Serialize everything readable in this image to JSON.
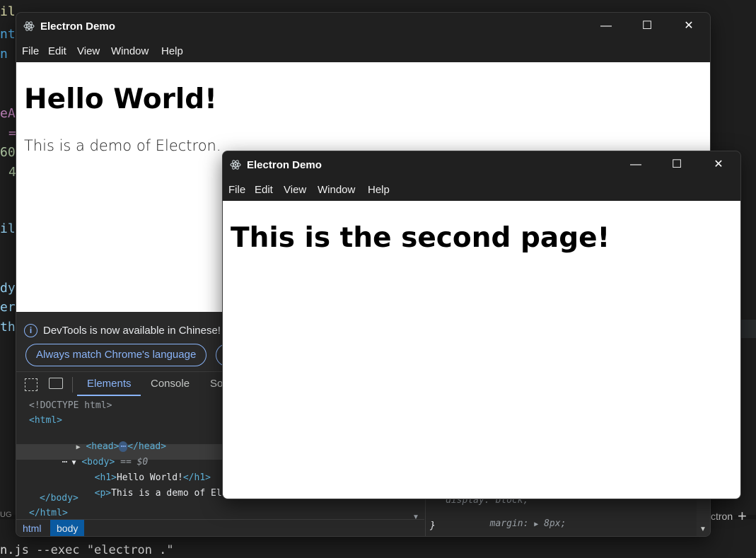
{
  "editor": {
    "code_fragments": [
      "il",
      "nt",
      "n",
      "eA",
      "=",
      "60",
      "4",
      "il",
      "dy",
      "er",
      "th"
    ],
    "terminal_command": "n.js --exec \"electron .\"",
    "status_left": "UG",
    "status_right": "ctron",
    "plus": "+"
  },
  "window_main": {
    "title": "Electron Demo",
    "menu": [
      "File",
      "Edit",
      "View",
      "Window",
      "Help"
    ],
    "controls": {
      "minimize": "—",
      "maximize": "☐",
      "close": "✕"
    },
    "heading": "Hello World!",
    "paragraph": "This is a demo of Electron."
  },
  "window_second": {
    "title": "Electron Demo",
    "menu": [
      "File",
      "Edit",
      "View",
      "Window",
      "Help"
    ],
    "controls": {
      "minimize": "—",
      "maximize": "☐",
      "close": "✕"
    },
    "heading": "This is the second page!"
  },
  "devtools": {
    "notice": "DevTools is now available in Chinese!",
    "lang_button": "Always match Chrome's language",
    "info_glyph": "i",
    "tabs": [
      "Elements",
      "Console",
      "So"
    ],
    "active_tab": "Elements",
    "dom": {
      "doctype": "<!DOCTYPE html>",
      "html_open": "<html>",
      "head_open": "<head>",
      "head_ellipsis": "⋯",
      "head_close": "</head>",
      "body_open": "<body>",
      "body_eq": "== $0",
      "h1_open": "<h1>",
      "h1_text": "Hello World!",
      "h1_close": "</h1>",
      "p_open": "<p>",
      "p_text": "This is a demo of Electron.",
      "p_close_partial": "<",
      "body_close": "</body>",
      "html_close": "</html>",
      "dots": "⋯"
    },
    "breadcrumb": [
      "html",
      "body"
    ],
    "active_crumb": "body",
    "styles": {
      "display_line": "display: block;",
      "margin_prop": "margin",
      "margin_value": "8px;",
      "close_brace": "}"
    }
  }
}
